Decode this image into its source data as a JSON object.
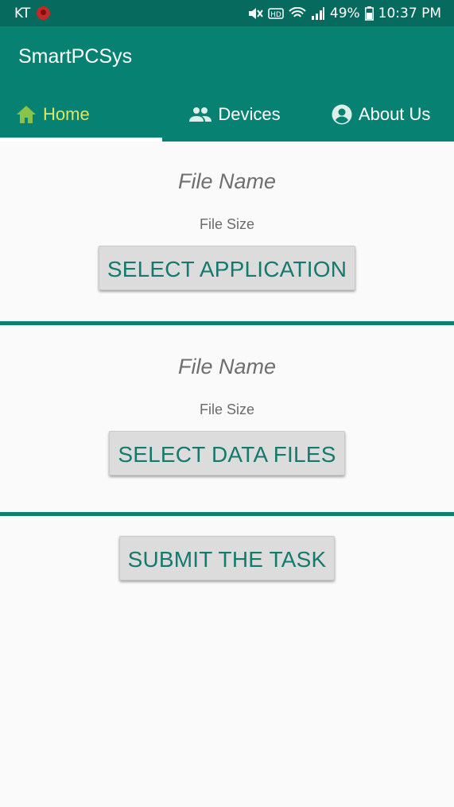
{
  "status_bar": {
    "carrier": "KT",
    "battery": "49%",
    "time": "10:37 PM"
  },
  "app_bar": {
    "title": "SmartPCSys"
  },
  "tabs": [
    {
      "label": "Home",
      "icon": "home-icon",
      "active": true
    },
    {
      "label": "Devices",
      "icon": "people-icon",
      "active": false
    },
    {
      "label": "About Us",
      "icon": "account-circle-icon",
      "active": false
    }
  ],
  "application_section": {
    "file_name": "File Name",
    "file_size": "File Size",
    "button_label": "SELECT APPLICATION"
  },
  "data_section": {
    "file_name": "File Name",
    "file_size": "File Size",
    "button_label": "SELECT DATA FILES"
  },
  "submit_section": {
    "button_label": "SUBMIT THE TASK"
  },
  "colors": {
    "status_bar": "#066b5e",
    "primary": "#078272",
    "active_tab": "#d7e86a",
    "button_text": "#157a6e",
    "divider": "#0b7f71"
  }
}
